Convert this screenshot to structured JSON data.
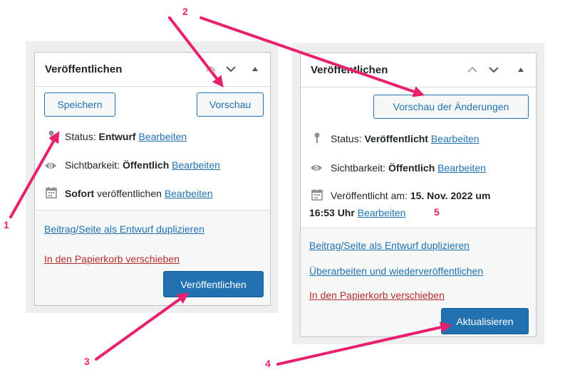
{
  "left_panel": {
    "title": "Veröffentlichen",
    "save_button": "Speichern",
    "preview_button": "Vorschau",
    "status_label": "Status:",
    "status_value": "Entwurf",
    "status_edit": "Bearbeiten",
    "visibility_label": "Sichtbarkeit:",
    "visibility_value": "Öffentlich",
    "visibility_edit": "Bearbeiten",
    "schedule_value": "Sofort",
    "schedule_label": "veröffentlichen",
    "schedule_edit": "Bearbeiten",
    "duplicate_link": "Beitrag/Seite als Entwurf duplizieren",
    "trash_link": "In den Papierkorb verschieben",
    "publish_button": "Veröffentlichen"
  },
  "right_panel": {
    "title": "Veröffentlichen",
    "preview_changes_button": "Vorschau der Änderungen",
    "status_label": "Status:",
    "status_value": "Veröffentlicht",
    "status_edit": "Bearbeiten",
    "visibility_label": "Sichtbarkeit:",
    "visibility_value": "Öffentlich",
    "visibility_edit": "Bearbeiten",
    "published_label": "Veröffentlicht am:",
    "published_date": "15. Nov. 2022 um",
    "published_time": "16:53 Uhr",
    "published_edit": "Bearbeiten",
    "duplicate_link": "Beitrag/Seite als Entwurf duplizieren",
    "revise_link": "Überarbeiten und wiederveröffentlichen",
    "trash_link": "In den Papierkorb verschieben",
    "update_button": "Aktualisieren"
  },
  "annotations": {
    "n1": "1",
    "n2": "2",
    "n3": "3",
    "n4": "4",
    "n5": "5"
  },
  "colors": {
    "accent": "#2271b1",
    "danger": "#b32d2e",
    "annotation": "#e8216e"
  }
}
